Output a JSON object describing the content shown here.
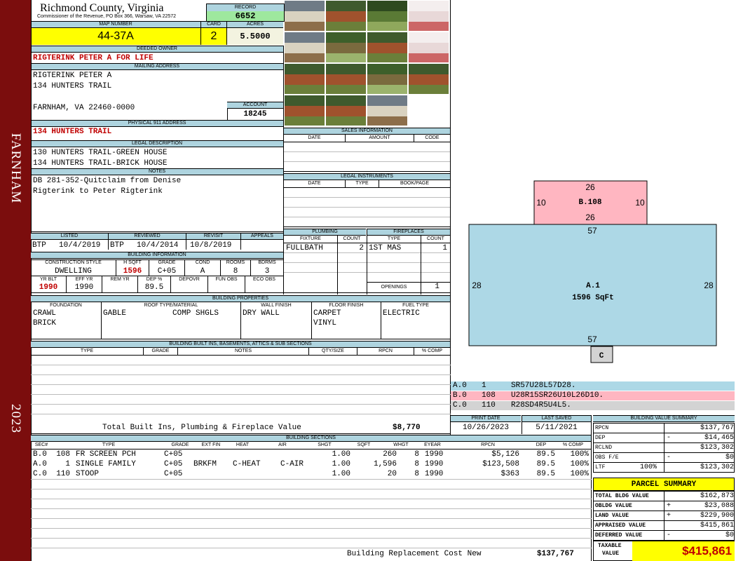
{
  "side": {
    "town": "FARNHAM",
    "year": "2023"
  },
  "header": {
    "county": "Richmond County, Virginia",
    "address": "Commissioner of the Revenue, PO Box 366, Warsaw, VA 22572",
    "record_label": "RECORD",
    "record": "6652",
    "map_label": "MAP NUMBER",
    "map": "44-37A",
    "card_label": "CARD",
    "card": "2",
    "acres_label": "ACRES",
    "acres": "5.5000"
  },
  "owner": {
    "deeded_label": "DEEDED OWNER",
    "deeded": "RIGTERINK PETER A FOR LIFE",
    "mailing_label": "MAILING ADDRESS",
    "mail_1": "RIGTERINK PETER A",
    "mail_2": "134 HUNTERS TRAIL",
    "mail_3": "FARNHAM, VA 22460-0000",
    "account_label": "ACCOUNT",
    "account": "18245",
    "physical_label": "PHYSICAL 911 ADDRESS",
    "physical": "134 HUNTERS TRAIL",
    "legal_label": "LEGAL DESCRIPTION",
    "legal_1": "130 HUNTERS TRAIL-GREEN HOUSE",
    "legal_2": "134 HUNTERS TRAIL-BRICK HOUSE",
    "notes_label": "NOTES",
    "notes_1": "DB 281-352-Quitclaim from Denise",
    "notes_2": "Rigterink to Peter Rigterink"
  },
  "dates": {
    "listed_label": "LISTED",
    "reviewed_label": "REVIEWED",
    "revisit_label": "REVISIT",
    "appeals_label": "APPEALS",
    "listed_by": "BTP",
    "listed": "10/4/2019",
    "reviewed_by": "BTP",
    "reviewed": "10/4/2014",
    "revisit": "10/8/2019"
  },
  "building_info": {
    "title": "BUILDING INFORMATION",
    "h_style": "CONSTRUCTION STYLE",
    "h_sqft": "H SQFT",
    "h_grade": "GRADE",
    "h_cond": "COND",
    "h_rooms": "ROOMS",
    "h_bdrms": "BDRMS",
    "style": "DWELLING",
    "sqft": "1596",
    "grade": "C+05",
    "cond": "A",
    "rooms": "8",
    "bdrms": "3",
    "h_yrblt": "YR BLT",
    "h_effyr": "EFF YR",
    "h_remyr": "REM YR",
    "h_dep": "DEP %",
    "h_depovr": "DEPOVR",
    "h_funobs": "FUN OBS",
    "h_ecoobs": "ECO OBS",
    "yrblt": "1990",
    "effyr": "1990",
    "dep": "89.5"
  },
  "sales": {
    "title": "SALES INFORMATION",
    "h_date": "DATE",
    "h_amount": "AMOUNT",
    "h_code": "CODE"
  },
  "legal_instr": {
    "title": "LEGAL INSTRUMENTS",
    "h_date": "DATE",
    "h_type": "TYPE",
    "h_book": "BOOK/PAGE"
  },
  "plumbing": {
    "title": "PLUMBING",
    "h_fixture": "FIXTURE",
    "h_count": "COUNT",
    "fixture": "FULLBATH",
    "count": "2"
  },
  "fireplaces": {
    "title": "FIREPLACES",
    "h_type": "TYPE",
    "h_count": "COUNT",
    "type": "1ST MAS",
    "count": "1",
    "openings_label": "OPENINGS",
    "openings": "1"
  },
  "properties": {
    "title": "BUILDING PROPERTIES",
    "h_foundation": "FOUNDATION",
    "h_roof": "ROOF TYPE/MATERIAL",
    "h_wall": "WALL FINISH",
    "h_floor": "FLOOR FINISH",
    "h_fuel": "FUEL TYPE",
    "foundation_1": "CRAWL",
    "foundation_2": "BRICK",
    "roof_type": "GABLE",
    "roof_mat": "COMP SHGLS",
    "wall": "DRY WALL",
    "floor_1": "CARPET",
    "floor_2": "VINYL",
    "fuel": "ELECTRIC"
  },
  "builtins": {
    "title": "BUILDING BUILT INS, BASEMENTS, ATTICS & SUB SECTIONS",
    "h_type": "TYPE",
    "h_grade": "GRADE",
    "h_notes": "NOTES",
    "h_qty": "QTY/SIZE",
    "h_rpcn": "RPCN",
    "h_comp": "% COMP",
    "total_label": "Total Built Ins, Plumbing & Fireplace Value",
    "total": "$8,770"
  },
  "sketch": {
    "b_top": "26",
    "b_left": "10",
    "b_right": "10",
    "b_label": "B.108",
    "b_bottom": "26",
    "a_top": "57",
    "a_left": "28",
    "a_right": "28",
    "a_label": "A.1",
    "a_sqft": "1596 SqFt",
    "a_bottom": "57",
    "c_label": "C"
  },
  "legend": [
    {
      "code": "A.0",
      "num": "1",
      "path": "SR57U28L57D28.",
      "color": "#add8e6"
    },
    {
      "code": "B.0",
      "num": "108",
      "path": "U28R15SR26U10L26D10.",
      "color": "#ffb6c1"
    },
    {
      "code": "C.0",
      "num": "110",
      "path": "R28SD4R5U4L5.",
      "color": "#d3d3d3"
    }
  ],
  "print": {
    "print_label": "PRINT DATE",
    "print": "10/26/2023",
    "saved_label": "LAST SAVED",
    "saved": "5/11/2021"
  },
  "sections": {
    "title": "BUILDING SECTIONS",
    "headers": [
      "SEC#",
      "TYPE",
      "GRADE",
      "EXT FIN",
      "HEAT",
      "AIR",
      "SHGT",
      "SQFT",
      "WHGT",
      "EYEAR",
      "RPCN",
      "DEP",
      "% COMP"
    ],
    "rows": [
      [
        "B.0",
        "108",
        "FR SCREEN PCH",
        "C+05",
        "",
        "",
        "",
        "1.00",
        "260",
        "8",
        "1990",
        "$5,126",
        "89.5",
        "100%"
      ],
      [
        "A.0",
        "1",
        "SINGLE FAMILY",
        "C+05",
        "BRKFM",
        "C-HEAT",
        "C-AIR",
        "1.00",
        "1,596",
        "8",
        "1990",
        "$123,508",
        "89.5",
        "100%"
      ],
      [
        "C.0",
        "110",
        "STOOP",
        "C+05",
        "",
        "",
        "",
        "1.00",
        "20",
        "8",
        "1990",
        "$363",
        "89.5",
        "100%"
      ]
    ],
    "replacement_label": "Building Replacement Cost New",
    "replacement": "$137,767"
  },
  "value_summary": {
    "title": "BUILDING VALUE SUMMARY",
    "rows": [
      {
        "label": "RPCN",
        "sign": "",
        "value": "$137,767"
      },
      {
        "label": "DEP",
        "sign": "-",
        "value": "$14,465"
      },
      {
        "label": "RCLND",
        "sign": "",
        "value": "$123,302"
      },
      {
        "label": "OBS F/E",
        "sign": "-",
        "value": "$0"
      },
      {
        "label": "LTF",
        "pct": "100%",
        "sign": "",
        "value": "$123,302"
      }
    ]
  },
  "parcel": {
    "title": "PARCEL SUMMARY",
    "rows": [
      {
        "label": "TOTAL BLDG VALUE",
        "sign": "",
        "value": "$162,873"
      },
      {
        "label": "OBLDG VALUE",
        "sign": "+",
        "value": "$23,088"
      },
      {
        "label": "LAND VALUE",
        "sign": "+",
        "value": "$229,900"
      },
      {
        "label": "APPRAISED VALUE",
        "sign": "",
        "value": "$415,861"
      },
      {
        "label": "DEFERRED VALUE",
        "sign": "-",
        "value": "$0"
      }
    ],
    "taxable_1": "TAXABLE",
    "taxable_2": "VALUE",
    "taxable": "$415,861"
  },
  "photos": [
    "garage-photo",
    "house-photo",
    "woods-photo",
    "document-photo",
    "garage-photo",
    "trees-photo",
    "house-photo",
    "document-photo",
    "house-photo",
    "house-photo",
    "trees-photo",
    "house-photo",
    "house-photo",
    "house-photo",
    "garage-photo"
  ]
}
